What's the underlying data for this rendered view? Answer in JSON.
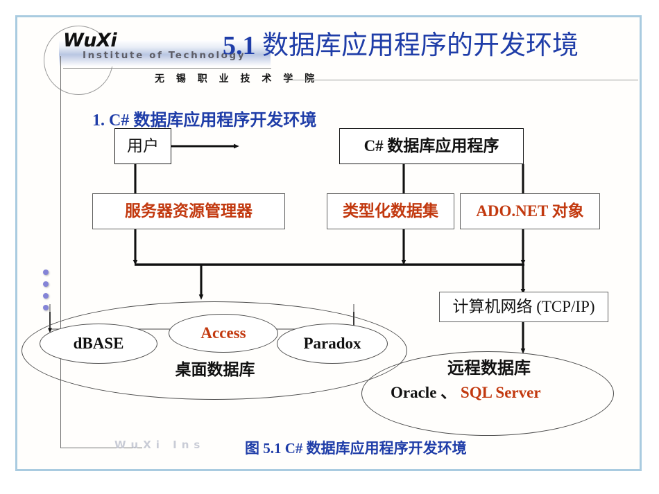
{
  "slide": {
    "logo": {
      "name_en": "WuXi",
      "institute_en": "Institute  of  Technology",
      "name_cn": "无 锡 职 业 技 术 学 院"
    },
    "title_number": "5.1",
    "title_text": "数据库应用程序的开发环境",
    "subtitle": "1. C# 数据库应用程序开发环境",
    "watermark": "WuXi  Ins",
    "figure_caption": "图 5.1 C# 数据库应用程序开发环境",
    "colors": {
      "title_blue": "#1f3da8",
      "accent_orange": "#c2390f",
      "frame_blue": "#a9cbe0",
      "text_black": "#111111",
      "dot_purple": "#6a6ad0"
    }
  },
  "diagram": {
    "boxes": [
      {
        "id": "user",
        "label": "用户",
        "style": "dark"
      },
      {
        "id": "csharp_app",
        "label": "C# 数据库应用程序",
        "style": "bold"
      },
      {
        "id": "server_res",
        "label": "服务器资源管理器",
        "style": "accent"
      },
      {
        "id": "typed_ds",
        "label": "类型化数据集",
        "style": "accent"
      },
      {
        "id": "ado_net",
        "label": "ADO.NET 对象",
        "style": "accent"
      },
      {
        "id": "network",
        "label": "计算机网络 (TCP/IP)",
        "style": "dark"
      }
    ],
    "desktop_group": {
      "label": "桌面数据库",
      "members": [
        {
          "id": "dbase",
          "label": "dBASE",
          "style": "bold"
        },
        {
          "id": "access",
          "label": "Access",
          "style": "accent"
        },
        {
          "id": "paradox",
          "label": "Paradox",
          "style": "bold"
        }
      ]
    },
    "remote_group": {
      "label": "远程数据库",
      "product_plain": "Oracle 、 ",
      "product_accent": "SQL Server"
    }
  }
}
